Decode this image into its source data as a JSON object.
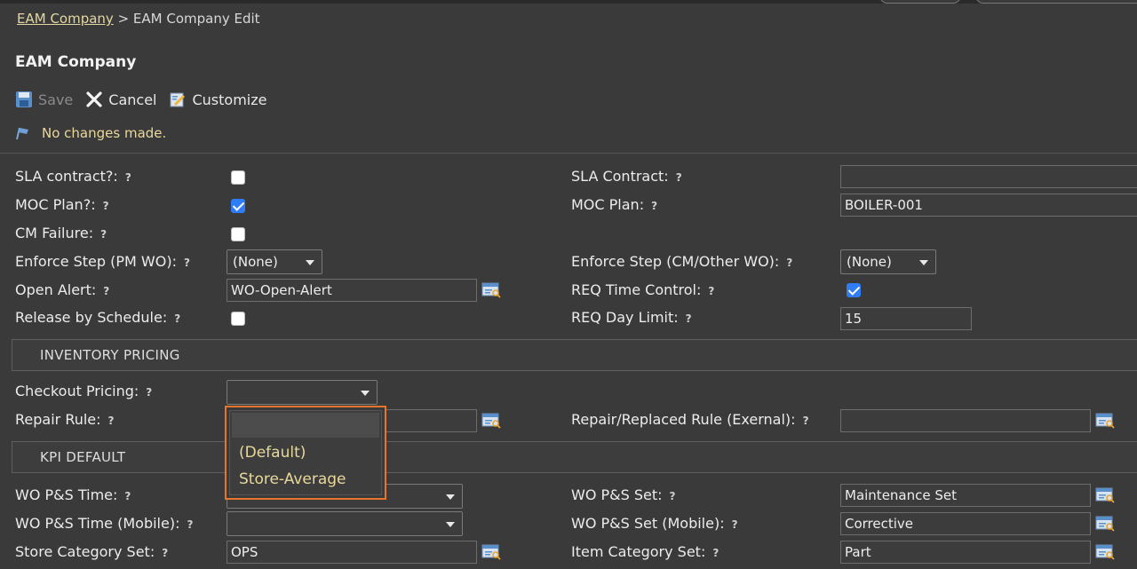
{
  "breadcrumb": {
    "link": "EAM Company",
    "separator": " > ",
    "current": "EAM Company Edit"
  },
  "page_title": "EAM Company",
  "toolbar": {
    "save": "Save",
    "cancel": "Cancel",
    "customize": "Customize"
  },
  "status_message": "No changes made.",
  "help_mark": "?",
  "fields": {
    "sla_contract_q": "SLA contract?:",
    "moc_plan_q": "MOC Plan?:",
    "cm_failure": "CM Failure:",
    "enforce_step_pm": "Enforce Step (PM WO):",
    "open_alert": "Open Alert:",
    "release_by_schedule": "Release by Schedule:",
    "sla_contract": "SLA Contract:",
    "moc_plan": "MOC Plan:",
    "enforce_step_cm": "Enforce Step (CM/Other WO):",
    "req_time_control": "REQ Time Control:",
    "req_day_limit": "REQ Day Limit:",
    "checkout_pricing": "Checkout Pricing:",
    "repair_rule": "Repair Rule:",
    "repair_replaced_rule": "Repair/Replaced Rule (Exernal):",
    "wo_ps_time": "WO P&S Time:",
    "wo_ps_time_mobile": "WO P&S Time (Mobile):",
    "store_category_set": "Store Category Set:",
    "wo_ps_set": "WO P&S Set:",
    "wo_ps_set_mobile": "WO P&S Set (Mobile):",
    "item_category_set": "Item Category Set:"
  },
  "values": {
    "sla_contract_checked": false,
    "moc_plan_checked": true,
    "cm_failure_checked": false,
    "release_by_schedule_checked": false,
    "req_time_control_checked": true,
    "enforce_step_pm": "(None)",
    "enforce_step_cm": "(None)",
    "open_alert": "WO-Open-Alert",
    "sla_contract": "",
    "moc_plan": "BOILER-001",
    "req_day_limit": "15",
    "checkout_pricing": "",
    "repair_rule": "",
    "repair_replaced_rule": "",
    "wo_ps_time": "",
    "wo_ps_time_mobile": "",
    "store_category_set": "OPS",
    "wo_ps_set": "Maintenance Set",
    "wo_ps_set_mobile": "Corrective",
    "item_category_set": "Part"
  },
  "sections": {
    "inventory_pricing": "INVENTORY PRICING",
    "kpi_default": "KPI DEFAULT"
  },
  "checkout_pricing_dropdown": {
    "options": [
      "",
      "(Default)",
      "Store-Average"
    ]
  },
  "colors": {
    "background": "#3a3a3a",
    "highlight": "#e7752b",
    "checkbox_on": "#2f7df6",
    "message": "#ead89a"
  }
}
